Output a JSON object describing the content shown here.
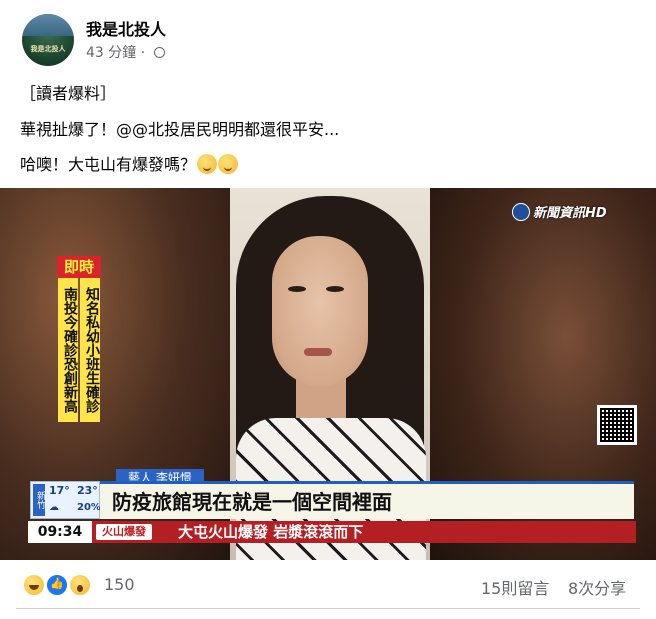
{
  "post": {
    "page_name": "我是北投人",
    "avatar_text": "我是北投人",
    "timestamp": "43 分鐘 ·",
    "lines": [
      "［讀者爆料］",
      "華視扯爆了！@@北投居民明明都還很平安...",
      "哈噢！大屯山有爆發嗎？"
    ]
  },
  "video": {
    "channel_logo": "新聞資訊HD",
    "breaking_tag": "即時",
    "side_col_1": "南投今確診恐創新高",
    "side_col_2": "知名私幼小班生確診",
    "name_tag": "藝人 李妍憬",
    "weather": {
      "label": "新竹",
      "temp_low": "17°",
      "temp_high": "23°",
      "rain": "20%"
    },
    "headline": "防疫旅館現在就是一個空間裡面",
    "clock": "09:34",
    "ticker_category": "火山爆發",
    "ticker_text": "大屯火山爆發 岩漿滾滾而下"
  },
  "footer": {
    "reaction_count": "150",
    "comments": "15則留言",
    "shares": "8次分享"
  }
}
